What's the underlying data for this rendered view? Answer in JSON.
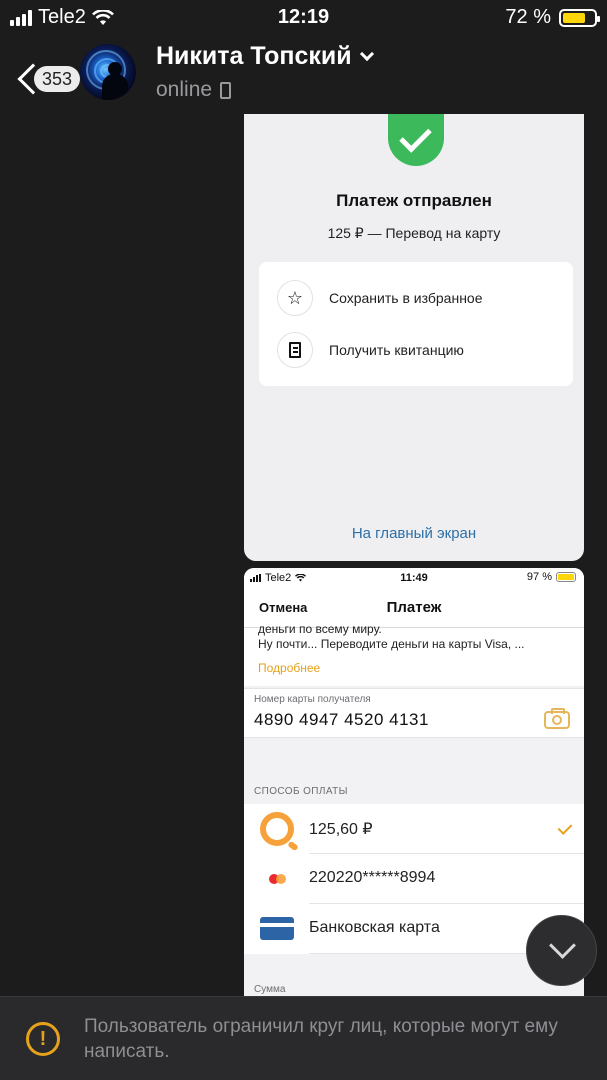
{
  "status_bar": {
    "carrier": "Tele2",
    "time": "12:19",
    "battery": "72 %",
    "battery_level": 0.72
  },
  "header": {
    "unread_count": "353",
    "contact_name": "Никита Топский",
    "status": "online"
  },
  "payment_confirmation": {
    "title": "Платеж отправлен",
    "subtitle": "125 ₽ — Перевод на карту",
    "actions": [
      {
        "label": "Сохранить в избранное",
        "icon": "star-icon"
      },
      {
        "label": "Получить квитанцию",
        "icon": "receipt-icon"
      }
    ],
    "home_link": "На главный экран"
  },
  "payment_form": {
    "status_bar": {
      "carrier": "Tele2",
      "time": "11:49",
      "battery": "97 %",
      "battery_level": 0.97
    },
    "nav": {
      "cancel": "Отмена",
      "title": "Платеж"
    },
    "info": {
      "cut_line": "деньги по всему миру.",
      "line2": "Ну почти... Переводите деньги на карты Visa, ...",
      "more_link": "Подробнее"
    },
    "card_field": {
      "label": "Номер карты получателя",
      "value": "4890 4947 4520 4131"
    },
    "section_label": "СПОСОБ ОПЛАТЫ",
    "methods": [
      {
        "label": "125,60 ₽",
        "icon": "qiwi-icon",
        "selected": true
      },
      {
        "label": "220220******8994",
        "icon": "mastercard-icon",
        "selected": false
      },
      {
        "label": "Банковская карта",
        "icon": "bank-card-icon",
        "selected": false
      }
    ],
    "sum_label": "Сумма"
  },
  "footer": {
    "notice": "Пользователь ограничил круг лиц, которые могут ему написать."
  },
  "colors": {
    "background": "#1c1c1d",
    "accent_yellow": "#e6a21a",
    "success_green": "#3bb95b",
    "link_blue": "#2c70a8"
  }
}
